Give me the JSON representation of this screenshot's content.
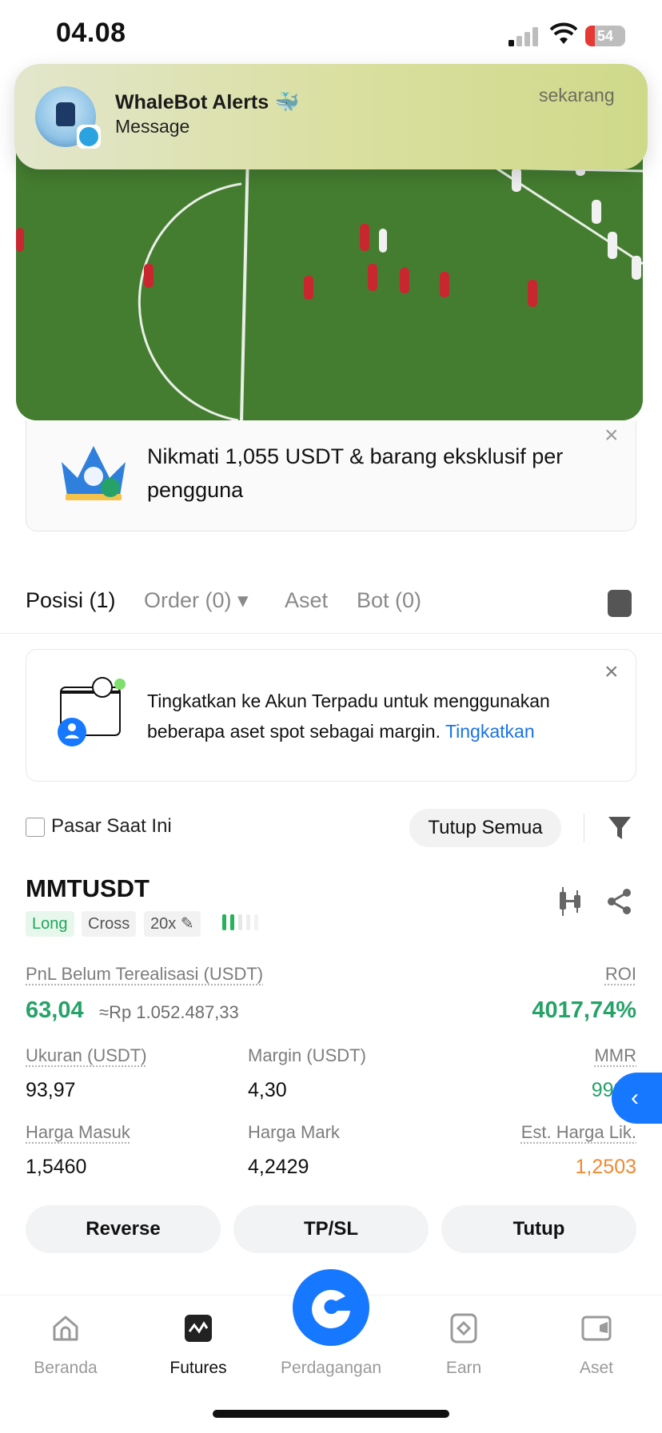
{
  "status_bar": {
    "time": "04.08",
    "battery": "54"
  },
  "notification": {
    "title": "WhaleBot Alerts 🐳",
    "subtitle": "Message",
    "time": "sekarang"
  },
  "promo": {
    "text": "Nikmati 1,055 USDT & barang eksklusif per pengguna"
  },
  "tabs": [
    {
      "label": "Posisi (1)"
    },
    {
      "label": "Order (0) ▾"
    },
    {
      "label": "Aset"
    },
    {
      "label": "Bot (0)"
    }
  ],
  "unified_account": {
    "text": "Tingkatkan ke Akun Terpadu untuk menggunakan beberapa aset spot sebagai margin.",
    "link": "Tingkatkan"
  },
  "filter": {
    "checkbox_label": "Pasar Saat Ini",
    "close_all": "Tutup Semua"
  },
  "position": {
    "pair": "MMTUSDT",
    "tags": {
      "side": "Long",
      "mode": "Cross",
      "leverage": "20x"
    },
    "pnl_label": "PnL Belum Terealisasi (USDT)",
    "pnl_value": "63,04",
    "pnl_idr": "≈Rp 1.052.487,33",
    "roi_label": "ROI",
    "roi_value": "4017,74%",
    "size_label": "Ukuran (USDT)",
    "size_value": "93,97",
    "margin_label": "Margin (USDT)",
    "margin_value": "4,30",
    "mmr_label": "MMR",
    "mmr_value": "999+",
    "entry_label": "Harga Masuk",
    "entry_value": "1,5460",
    "mark_label": "Harga Mark",
    "mark_value": "4,2429",
    "liq_label": "Est. Harga Lik.",
    "liq_value": "1,2503"
  },
  "actions": {
    "reverse": "Reverse",
    "tpsl": "TP/SL",
    "close": "Tutup"
  },
  "nav": [
    {
      "label": "Beranda",
      "icon": "home-icon"
    },
    {
      "label": "Futures",
      "icon": "futures-icon"
    },
    {
      "label": "Perdagangan",
      "icon": "trade-icon"
    },
    {
      "label": "Earn",
      "icon": "earn-icon"
    },
    {
      "label": "Aset",
      "icon": "wallet-icon"
    }
  ],
  "colors": {
    "accent": "#1677ff",
    "profit": "#26a269",
    "liq": "#f08a32"
  }
}
